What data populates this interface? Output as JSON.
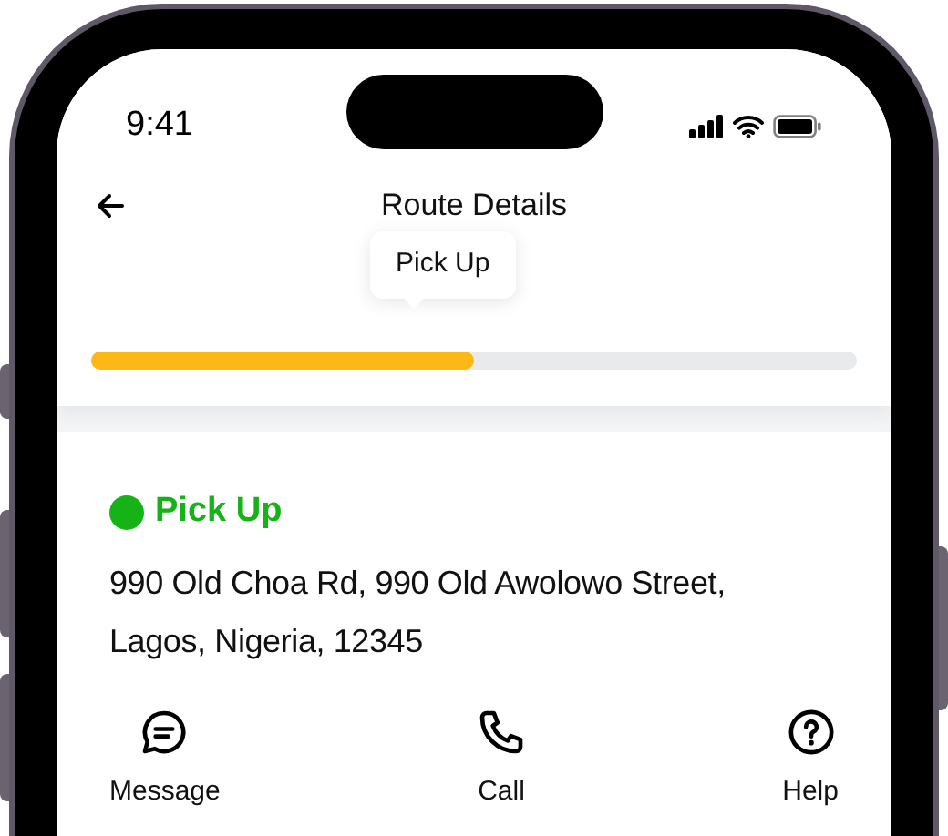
{
  "status_bar": {
    "time": "9:41"
  },
  "header": {
    "title": "Route Details"
  },
  "progress": {
    "label": "Pick Up",
    "level": 0.5
  },
  "stop": {
    "status": "Pick Up",
    "color": "#16b316",
    "address": "990 Old Choa Rd, 990 Old Awolowo Street, Lagos, Nigeria, 12345"
  },
  "actions": [
    {
      "kind": "message",
      "label": "Message"
    },
    {
      "kind": "call",
      "label": "Call"
    },
    {
      "kind": "help",
      "label": "Help"
    }
  ]
}
